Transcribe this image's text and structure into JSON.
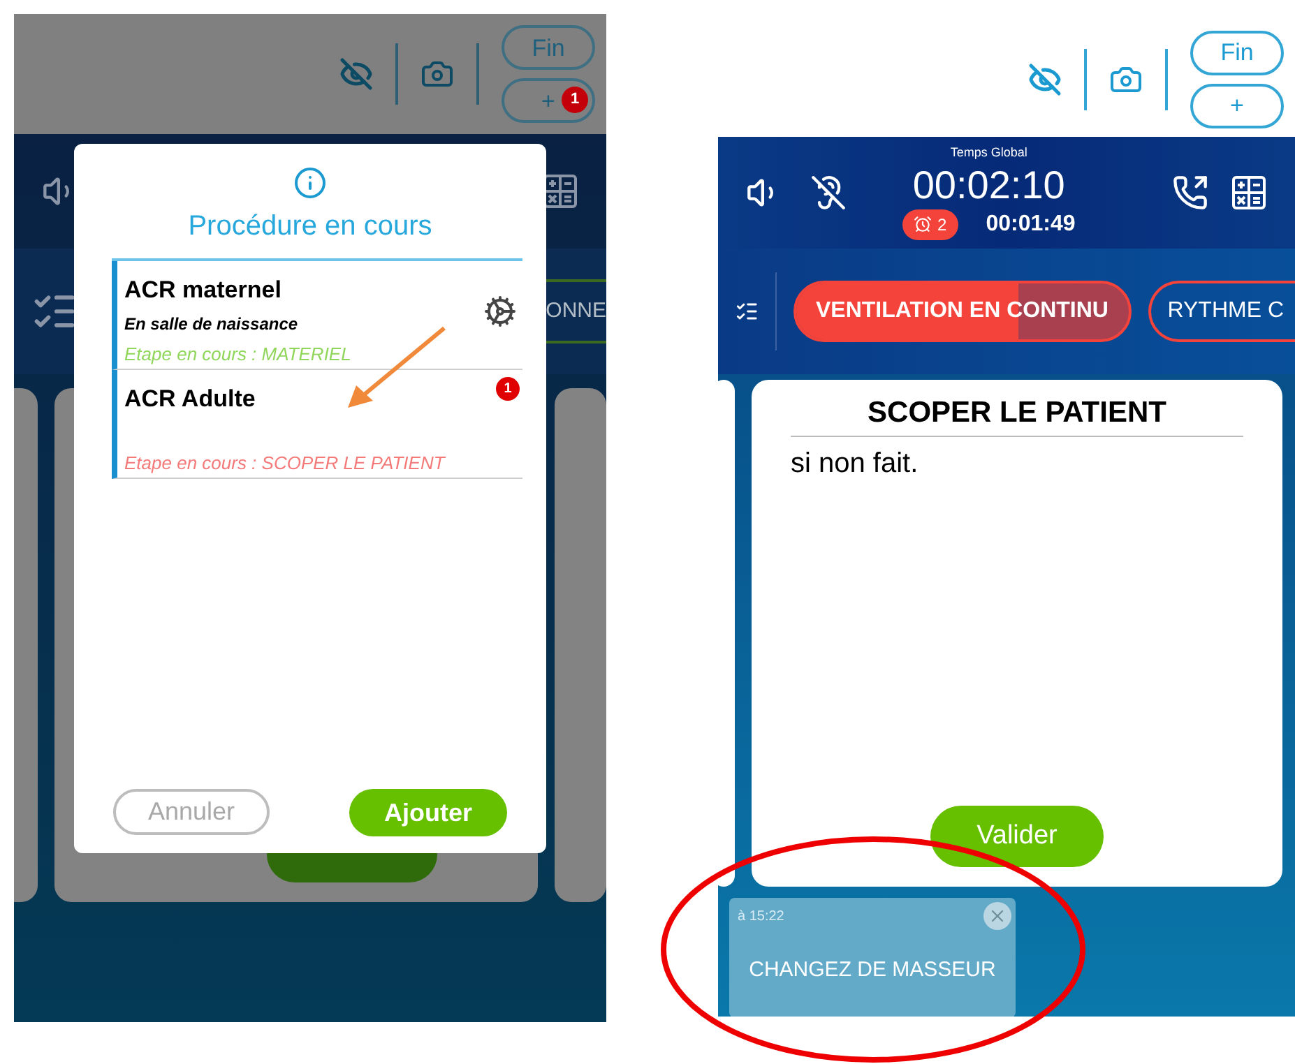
{
  "left_screen": {
    "toolbar_buttons": [
      {
        "label": "Fin"
      },
      {
        "label": "+",
        "badge": "1"
      }
    ],
    "tab_chip": "ONNE",
    "dialog": {
      "title": "Procédure en cours",
      "procedures": [
        {
          "name": "ACR maternel",
          "subtitle": "En salle de naissance",
          "step": "Etape en cours : MATERIEL",
          "color": "#8fd65a",
          "kind": "gear"
        },
        {
          "name": "ACR Adulte",
          "step": "Etape en cours : SCOPER LE PATIENT",
          "color": "#f47a7a",
          "kind": "badge",
          "badge": "1"
        }
      ],
      "buttons": [
        {
          "label": "Annuler",
          "kind": "cancel"
        },
        {
          "label": "Ajouter",
          "kind": "confirm"
        }
      ]
    }
  },
  "right_screen": {
    "toolbar_buttons": [
      {
        "label": "Fin"
      },
      {
        "label": "+"
      }
    ],
    "timer": {
      "label": "Temps Global",
      "global": "00:02:10",
      "alarm_count": "2",
      "elapsed": "00:01:49"
    },
    "tabs": [
      {
        "label": "VENTILATION EN CONTINU",
        "selected": true,
        "level": 0.67
      },
      {
        "label": "RYTHME C",
        "selected": false
      }
    ],
    "card": {
      "title": "SCOPER LE PATIENT",
      "body": "si non fait.",
      "button": "Valider"
    },
    "toast": {
      "time": "à 15:22",
      "message": "CHANGEZ DE MASSEUR"
    }
  }
}
